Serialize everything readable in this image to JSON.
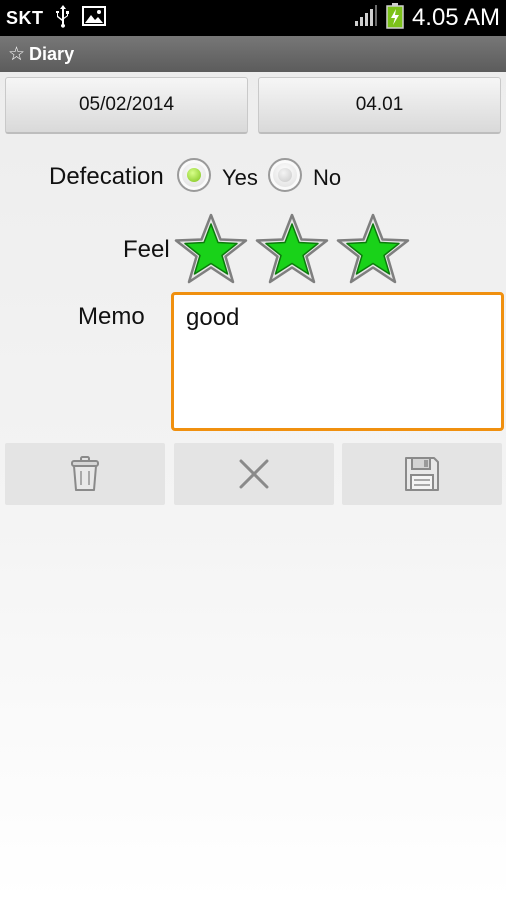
{
  "status_bar": {
    "carrier": "SKT",
    "time": "4.05 AM",
    "icons": [
      "usb-icon",
      "image-icon",
      "signal-icon",
      "battery-charging-icon"
    ]
  },
  "app_bar": {
    "icon": "star-icon",
    "title": "Diary"
  },
  "date_button": {
    "label": "05/02/2014"
  },
  "time_button": {
    "label": "04.01"
  },
  "defecation": {
    "label": "Defecation",
    "options": [
      "Yes",
      "No"
    ],
    "selected": "Yes"
  },
  "feel": {
    "label": "Feel",
    "rating": 3,
    "max": 3,
    "star_color": "#19d219"
  },
  "memo": {
    "label": "Memo",
    "value": "good",
    "focus_color": "#f0900f"
  },
  "actions": {
    "icons": [
      "trash-icon",
      "close-icon",
      "floppy-save-icon"
    ]
  }
}
